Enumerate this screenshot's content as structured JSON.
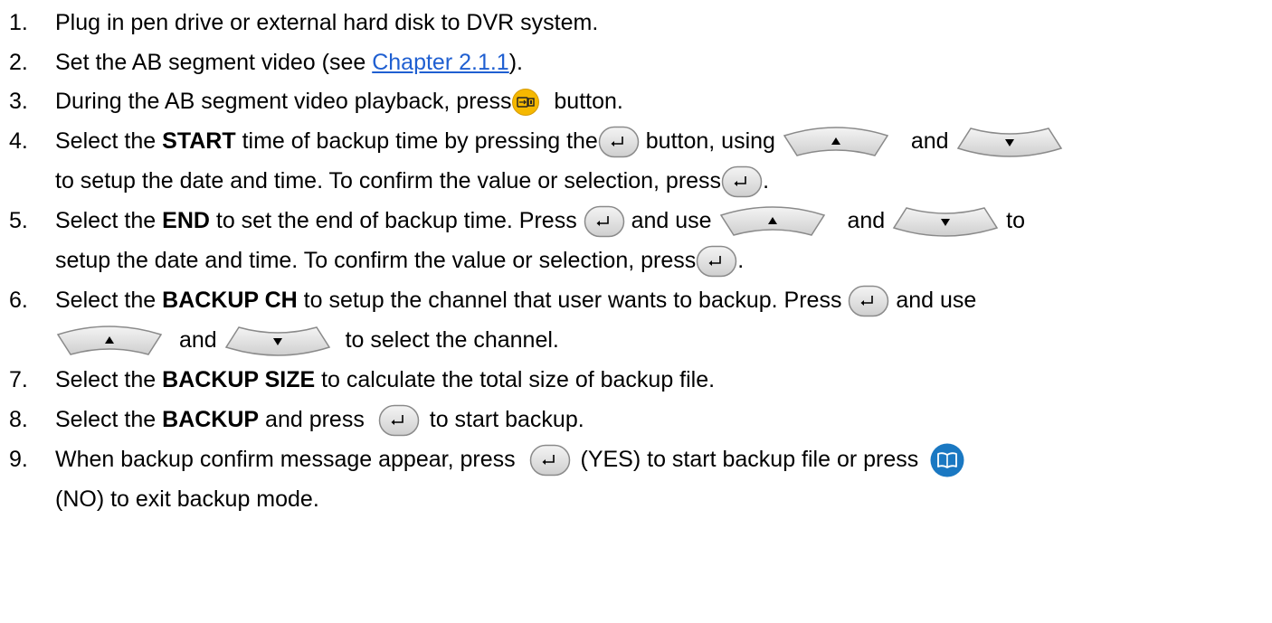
{
  "steps": [
    {
      "num": "1.",
      "text": "Plug in pen drive or external hard disk to DVR system."
    },
    {
      "num": "2.",
      "pre": "Set the AB segment video (see ",
      "link": "Chapter 2.1.1",
      "post": ")."
    },
    {
      "num": "3.",
      "pre": "During the AB segment video playback, press",
      "post": "button."
    },
    {
      "num": "4.",
      "a": "Select the ",
      "b": "START",
      "c": " time of backup time by pressing the",
      "d": "button, using",
      "e": "and",
      "cont": "to setup the date and time. To confirm the value or selection, press",
      "cont_end": "."
    },
    {
      "num": "5.",
      "a": "Select the ",
      "b": "END",
      "c": " to set the end of backup time. Press",
      "d": "and use",
      "e": "and",
      "f": "to",
      "cont": "setup the date and time. To confirm the value or selection, press",
      "cont_end": "."
    },
    {
      "num": "6.",
      "a": "Select the ",
      "b": "BACKUP CH",
      "c": " to setup the channel that user wants to backup. Press",
      "d": "and use",
      "cont_mid": "and",
      "cont": "to select the channel."
    },
    {
      "num": "7.",
      "a": "Select the ",
      "b": "BACKUP SIZE",
      "c": " to calculate the total size of backup file."
    },
    {
      "num": "8.",
      "a": "Select the ",
      "b": "BACKUP",
      "c": " and press",
      "d": "to start backup."
    },
    {
      "num": "9.",
      "a": "When backup confirm message appear, press",
      "d": "(YES) to start backup file or press",
      "cont": "(NO) to exit backup mode."
    }
  ],
  "colors": {
    "link": "#1f5fd1",
    "usb_button": "#f5b800",
    "book_button": "#1a78c2"
  },
  "icons": [
    "enter-button-icon",
    "up-arrow-button-icon",
    "down-arrow-button-icon",
    "usb-backup-button-icon",
    "book-button-icon"
  ]
}
